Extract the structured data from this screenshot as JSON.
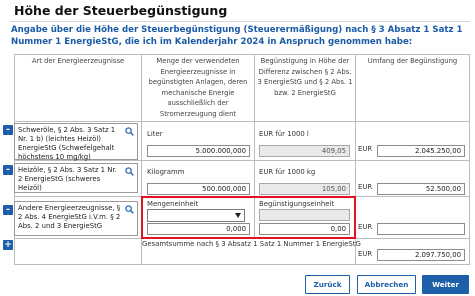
{
  "page": {
    "title": "Höhe der Steuerbegünstigung",
    "intro": "Angabe über die Höhe der Steuerbegünstigung (Steuerermäßigung) nach § 3 Absatz 1 Satz 1 Nummer 1 EnergieStG, die ich im Kalenderjahr 2024 in Anspruch genommen habe:"
  },
  "table": {
    "headers": {
      "col1": "Art der Energieerzeugnisse",
      "col2": "Menge der verwendeten Energieerzeugnisse in begünstigten Anlagen, deren mechanische Energie ausschließlich der Stromerzeugung dient",
      "col3": "Begünstigung in Höhe der Differenz zwischen § 2 Abs. 3 EnergieStG und § 2 Abs. 1 bzw. 2 EnergieStG",
      "col4": "Umfang der Begünstigung"
    },
    "rows": [
      {
        "item": "Schweröle, § 2 Abs. 3 Satz 1 Nr. 1 b) (leichtes Heizöl) EnergieStG (Schwefelgehalt höchstens 10 mg/kg)",
        "quantity_unit": "Liter",
        "quantity": "5.000.000,000",
        "rate_unit": "EUR für 1000 l",
        "rate": "409,05",
        "amount_unit": "EUR",
        "amount": "2.045.250,00"
      },
      {
        "item": "Heizöle, § 2 Abs. 3 Satz 1 Nr. 2 EnergieStG (schweres Heizöl)",
        "quantity_unit": "Kilogramm",
        "quantity": "500.000,000",
        "rate_unit": "EUR für 1000 kg",
        "rate": "105,00",
        "amount_unit": "EUR",
        "amount": "52.500,00"
      },
      {
        "item": "Andere Energieerzeugnisse, § 2 Abs. 4 EnergieStG i.V.m. § 2 Abs. 2 und 3 EnergieStG",
        "quantity_unit": "Mengeneinheit",
        "quantity": "0,000",
        "rate_unit": "Begünstigungseinheit",
        "rate": "0,00",
        "amount_unit": "EUR",
        "amount": ""
      }
    ],
    "total_label": "Gesamtsumme nach § 3 Absatz 1 Satz 1 Nummer 1 EnergieStG",
    "total_unit": "EUR",
    "total_value": "2.097.750,00"
  },
  "controls": {
    "remove_symbol": "-",
    "add_symbol": "+"
  },
  "buttons": {
    "back": "Zurück",
    "cancel": "Abbrechen",
    "next": "Weiter"
  },
  "colors": {
    "accent": "#1d5fa8",
    "highlight": "#e0141e"
  },
  "icons": {
    "lookup": "magnifier-icon",
    "select": "chevron-down-icon"
  }
}
